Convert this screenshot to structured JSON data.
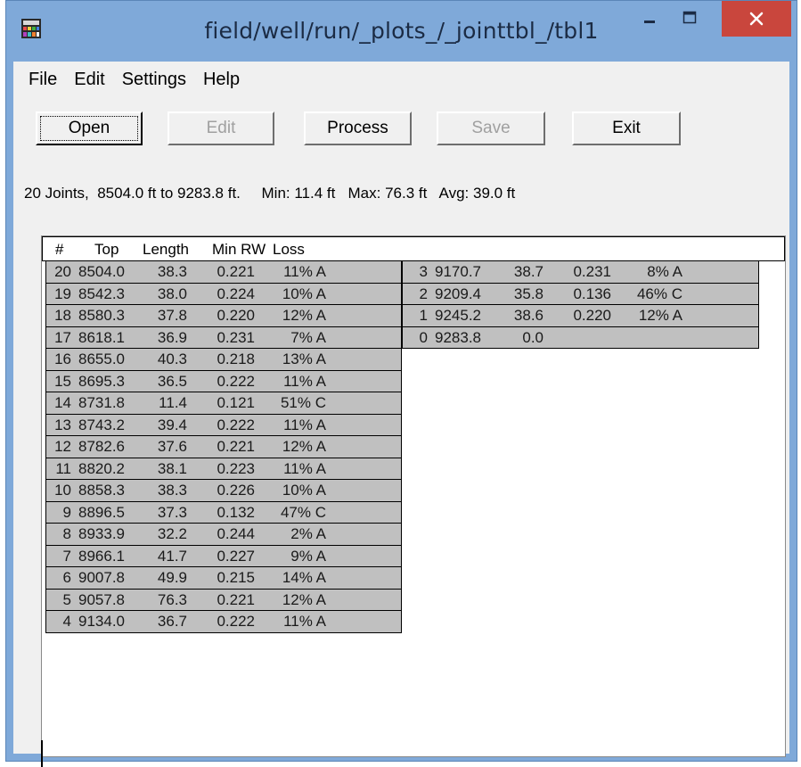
{
  "window": {
    "title": "field/well/run/_plots_/_jointtbl_/tbl1",
    "minimize_glyph": "–",
    "maximize_glyph": "□",
    "close_glyph": "✕",
    "accent": "#c9463d"
  },
  "menu": [
    "File",
    "Edit",
    "Settings",
    "Help"
  ],
  "toolbar": {
    "open": "Open",
    "edit": "Edit",
    "process": "Process",
    "save": "Save",
    "exit": "Exit"
  },
  "summary": "20 Joints,  8504.0 ft to 9283.8 ft.     Min: 11.4 ft   Max: 76.3 ft   Avg: 39.0 ft",
  "table": {
    "headers": [
      "#",
      "Top",
      "Length",
      "Min RW",
      "Loss"
    ],
    "left_rows": [
      [
        "20",
        "8504.0",
        "38.3",
        "0.221",
        "11% A"
      ],
      [
        "19",
        "8542.3",
        "38.0",
        "0.224",
        "10% A"
      ],
      [
        "18",
        "8580.3",
        "37.8",
        "0.220",
        "12% A"
      ],
      [
        "17",
        "8618.1",
        "36.9",
        "0.231",
        "7% A"
      ],
      [
        "16",
        "8655.0",
        "40.3",
        "0.218",
        "13% A"
      ],
      [
        "15",
        "8695.3",
        "36.5",
        "0.222",
        "11% A"
      ],
      [
        "14",
        "8731.8",
        "11.4",
        "0.121",
        "51% C"
      ],
      [
        "13",
        "8743.2",
        "39.4",
        "0.222",
        "11% A"
      ],
      [
        "12",
        "8782.6",
        "37.6",
        "0.221",
        "12% A"
      ],
      [
        "11",
        "8820.2",
        "38.1",
        "0.223",
        "11% A"
      ],
      [
        "10",
        "8858.3",
        "38.3",
        "0.226",
        "10% A"
      ],
      [
        "9",
        "8896.5",
        "37.3",
        "0.132",
        "47% C"
      ],
      [
        "8",
        "8933.9",
        "32.2",
        "0.244",
        "2% A"
      ],
      [
        "7",
        "8966.1",
        "41.7",
        "0.227",
        "9% A"
      ],
      [
        "6",
        "9007.8",
        "49.9",
        "0.215",
        "14% A"
      ],
      [
        "5",
        "9057.8",
        "76.3",
        "0.221",
        "12% A"
      ],
      [
        "4",
        "9134.0",
        "36.7",
        "0.222",
        "11% A"
      ]
    ],
    "right_rows": [
      [
        "3",
        "9170.7",
        "38.7",
        "0.231",
        "8% A"
      ],
      [
        "2",
        "9209.4",
        "35.8",
        "0.136",
        "46% C"
      ],
      [
        "1",
        "9245.2",
        "38.6",
        "0.220",
        "12% A"
      ],
      [
        "0",
        "9283.8",
        "0.0",
        "",
        ""
      ]
    ]
  }
}
